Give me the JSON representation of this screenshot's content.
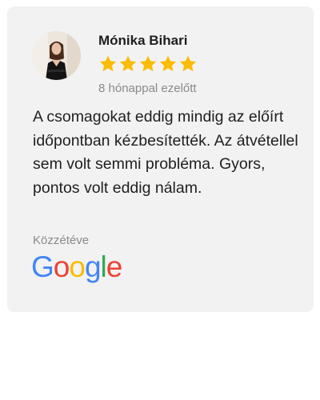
{
  "review": {
    "author_name": "Mónika Bihari",
    "rating": 5,
    "rating_max": 5,
    "star_icon": "star-icon",
    "star_color": "#fbbc05",
    "time_ago": "8 hónappal ezelőtt",
    "text": "A csomagokat eddig mindig az előírt időpontban kézbesítették. Az átvétellel sem volt semmi probléma. Gyors, pontos volt eddig nálam.",
    "published_label": "Közzétéve"
  },
  "source_logo": {
    "text": "Google",
    "letter_colors": [
      "#4285f4",
      "#ea4335",
      "#fbbc05",
      "#4285f4",
      "#34a853",
      "#ea4335"
    ]
  },
  "colors": {
    "card_background": "#f2f2f2",
    "text_primary": "#1f1f1f",
    "text_secondary": "#8a8a8a"
  }
}
